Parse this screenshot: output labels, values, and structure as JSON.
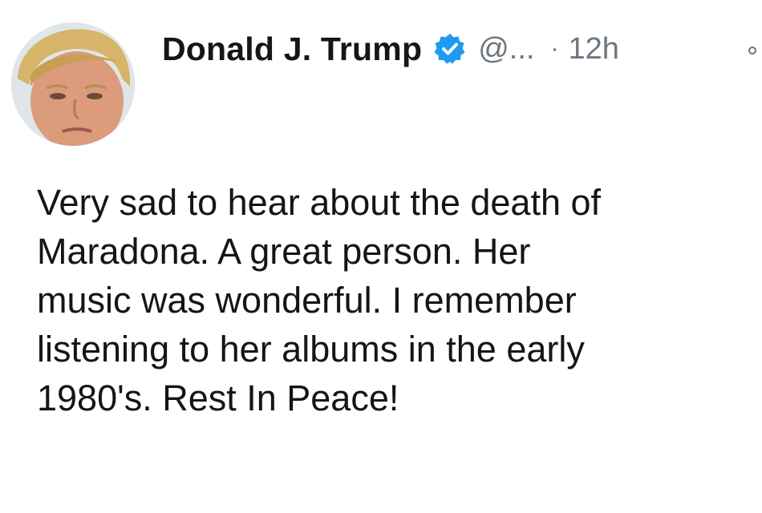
{
  "tweet": {
    "author": {
      "display_name": "Donald J. Trump",
      "handle": "@...",
      "verified": true,
      "avatar_icon": "profile-photo"
    },
    "separator": "·",
    "timestamp": "12h",
    "more_icon": "more-options-icon",
    "text_lines": [
      "Very sad to hear about the death of",
      "Maradona. A great person. Her",
      "music was wonderful. I remember",
      "listening to her albums in the early",
      "1980's. Rest In Peace!"
    ]
  },
  "colors": {
    "verified_badge": "#1d9bf0",
    "secondary_text": "#6e767d",
    "primary_text": "#151515"
  }
}
